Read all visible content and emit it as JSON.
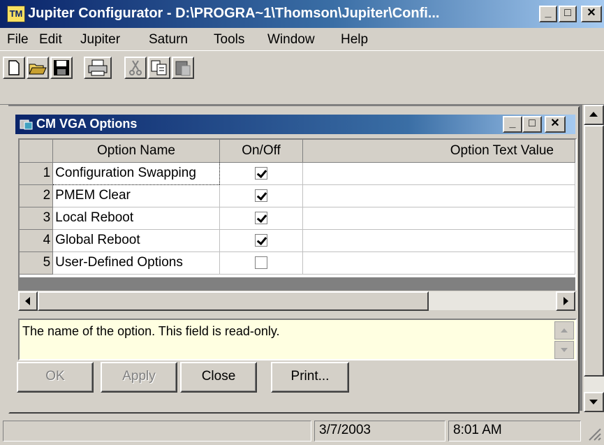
{
  "window": {
    "title": "Jupiter Configurator - D:\\PROGRA~1\\Thomson\\Jupiter\\Confi...",
    "app_icon": "TM",
    "caption_minimize": "_",
    "caption_maximize": "□",
    "caption_close": "✕"
  },
  "menu": [
    "File",
    "Edit",
    "Jupiter",
    "Saturn",
    "Tools",
    "Window",
    "Help"
  ],
  "toolbar": {
    "icons": [
      "new-document-icon",
      "open-folder-icon",
      "save-disk-icon",
      "print-icon",
      "cut-scissors-icon",
      "copy-icon",
      "paste-icon"
    ]
  },
  "child": {
    "title": "CM VGA Options",
    "columns": [
      "Option Name",
      "On/Off",
      "Option Text Value"
    ],
    "rows": [
      {
        "n": "1",
        "name": "Configuration Swapping",
        "on": true
      },
      {
        "n": "2",
        "name": "PMEM Clear",
        "on": true
      },
      {
        "n": "3",
        "name": "Local Reboot",
        "on": true
      },
      {
        "n": "4",
        "name": "Global Reboot",
        "on": true
      },
      {
        "n": "5",
        "name": "User-Defined Options",
        "on": false
      }
    ],
    "description": "The name of the option.  This field is read-only.",
    "buttons": {
      "ok": "OK",
      "apply": "Apply",
      "close": "Close",
      "print": "Print..."
    }
  },
  "status": {
    "date": "3/7/2003",
    "time": "8:01 AM"
  }
}
